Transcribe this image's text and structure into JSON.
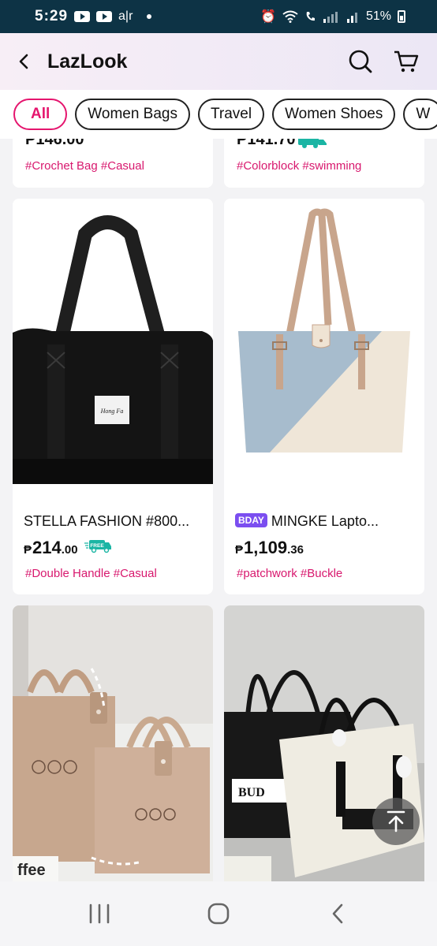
{
  "status_bar": {
    "time": "5:29",
    "air_label": "a|r",
    "battery": "51%"
  },
  "header": {
    "title": "LazLook"
  },
  "chips": [
    {
      "label": "All",
      "active": true
    },
    {
      "label": "Women Bags",
      "active": false
    },
    {
      "label": "Travel",
      "active": false
    },
    {
      "label": "Women Shoes",
      "active": false
    },
    {
      "label": "W",
      "active": false
    }
  ],
  "products": [
    {
      "tags": "#Crochet Bag #Casual",
      "price_partial": "₱146.00"
    },
    {
      "tags": "#Colorblock #swimming",
      "price_partial": "₱141.70"
    },
    {
      "name": "STELLA FASHION #800...",
      "price_main": "214",
      "price_dec": ".00",
      "free_shipping": true,
      "tags": "#Double Handle #Casual"
    },
    {
      "badge": "BDAY",
      "name": "MINGKE Lapto...",
      "price_main": "1,109",
      "price_dec": ".36",
      "free_shipping": false,
      "tags": "#patchwork #Buckle"
    }
  ],
  "currency": "₱",
  "free_label": "FREE",
  "image_texts": {
    "black_bag_label": "Hong Fa",
    "felt_text": "ffee",
    "canvas_bag_label": "BUD"
  },
  "colors": {
    "accent": "#e5156e",
    "tag": "#d8186e",
    "status_bar": "#0d3345",
    "free_teal": "#1bb5a4",
    "bday_purple": "#7b4ef0"
  }
}
